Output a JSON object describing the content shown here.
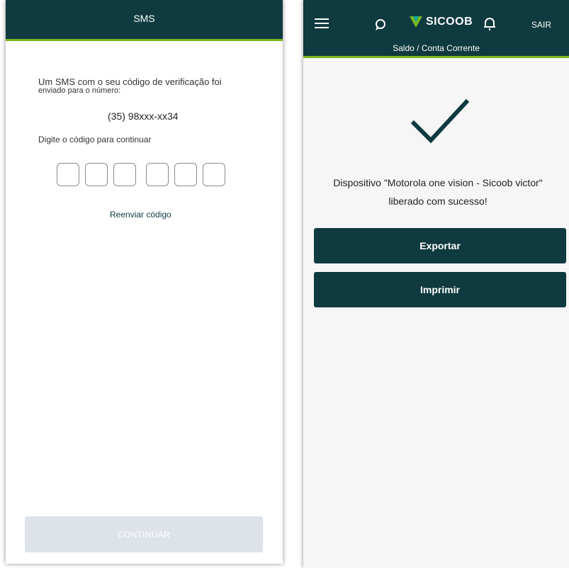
{
  "left_screen": {
    "header_title": "SMS",
    "message_line1": "Um SMS com o seu código de verificação foi",
    "message_line2": "enviado para o número:",
    "phone_number": "(35) 98xxx-xx34",
    "prompt": "Digite o código para continuar",
    "code_digits": [
      "",
      "",
      "",
      "",
      "",
      ""
    ],
    "resend_label": "Reenviar código",
    "continue_label": "CONTINUAR"
  },
  "right_screen": {
    "logo_text": "SICOOB",
    "logout_label": "SAIR",
    "subtitle": "Saldo / Conta Corrente",
    "success_message": "Dispositivo \"Motorola one vision - Sicoob victor\" liberado com sucesso!",
    "export_label": "Exportar",
    "print_label": "Imprimir",
    "icons": [
      "menu-icon",
      "chat-icon",
      "sicoob-logo-icon",
      "bell-icon",
      "check-icon"
    ]
  },
  "colors": {
    "primary": "#0f3a3f",
    "accent": "#7ab51d",
    "disabled_button": "#dde3e8"
  }
}
